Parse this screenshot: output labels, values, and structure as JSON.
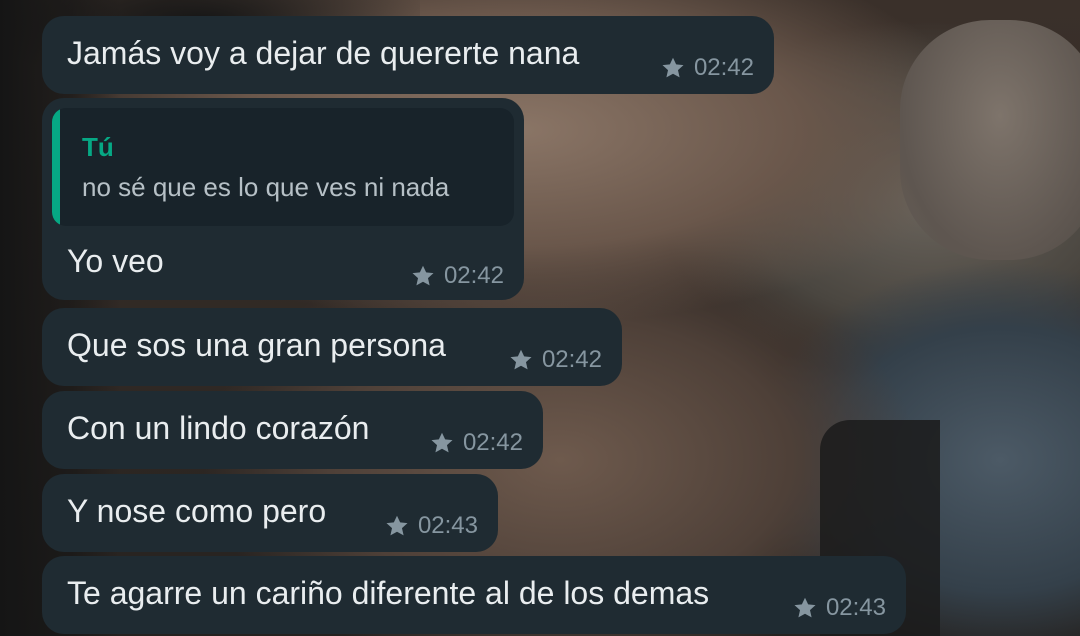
{
  "messages": [
    {
      "text": "Jamás  voy a dejar de quererte nana",
      "time": "02:42",
      "starred": true
    },
    {
      "quote": {
        "author": "Tú",
        "text": "no sé que es lo que ves ni nada"
      },
      "text": "Yo veo",
      "time": "02:42",
      "starred": true
    },
    {
      "text": "Que sos una gran persona",
      "time": "02:42",
      "starred": true
    },
    {
      "text": "Con un lindo corazón",
      "time": "02:42",
      "starred": true
    },
    {
      "text": "Y nose como pero",
      "time": "02:43",
      "starred": true
    },
    {
      "text": "Te agarre un cariño diferente al de los demas",
      "time": "02:43",
      "starred": true
    }
  ],
  "colors": {
    "bubble_bg": "#1f2b32",
    "text": "#e9edef",
    "meta": "#8696a0",
    "quote_accent": "#06a884"
  },
  "icons": {
    "starred": "star-icon"
  }
}
